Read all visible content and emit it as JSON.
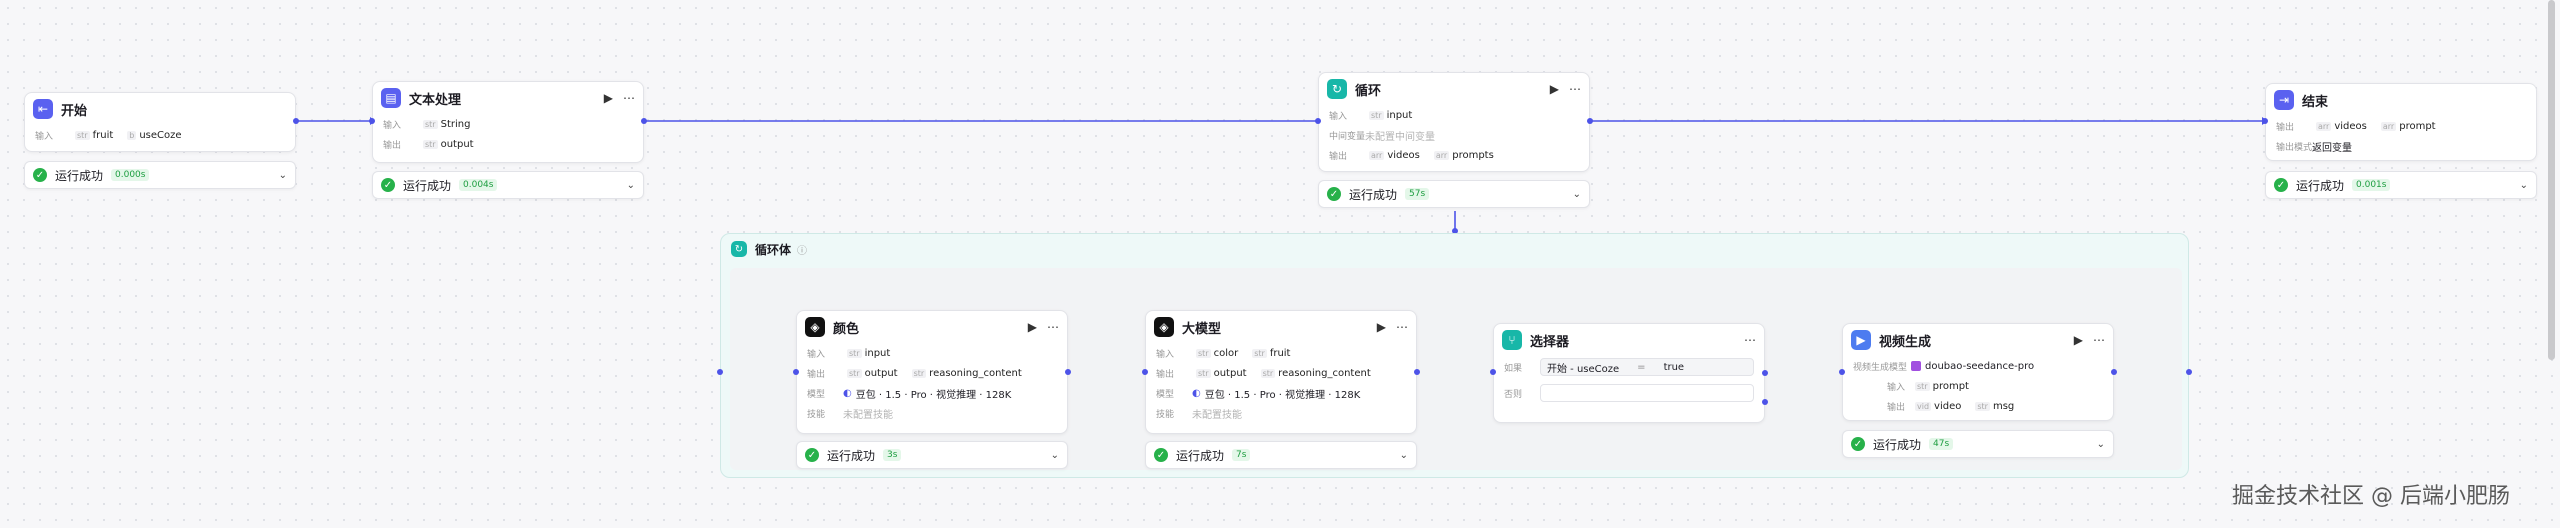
{
  "nodes": {
    "start": {
      "title": "开始",
      "input_label": "输入",
      "inputs": [
        {
          "type": "str",
          "name": "fruit"
        },
        {
          "type": "b",
          "name": "useCoze"
        }
      ],
      "status": "运行成功",
      "time": "0.000s"
    },
    "text": {
      "title": "文本处理",
      "input_label": "输入",
      "output_label": "输出",
      "inputs": [
        {
          "type": "str",
          "name": "String"
        }
      ],
      "outputs": [
        {
          "type": "str",
          "name": "output"
        }
      ],
      "status": "运行成功",
      "time": "0.004s"
    },
    "loop": {
      "title": "循环",
      "input_label": "输入",
      "mid_label": "中间变量",
      "output_label": "输出",
      "inputs": [
        {
          "type": "str",
          "name": "input"
        }
      ],
      "mid_value": "未配置中间变量",
      "outputs": [
        {
          "type": "arr",
          "name": "videos"
        },
        {
          "type": "arr",
          "name": "prompts"
        }
      ],
      "status": "运行成功",
      "time": "57s"
    },
    "end": {
      "title": "结束",
      "output_label": "输出",
      "mode_label": "输出模式",
      "outputs": [
        {
          "type": "arr",
          "name": "videos"
        },
        {
          "type": "arr",
          "name": "prompt"
        }
      ],
      "mode_value": "返回变量",
      "status": "运行成功",
      "time": "0.001s"
    },
    "loop_body": {
      "title": "循环体"
    },
    "color": {
      "title": "颜色",
      "input_label": "输入",
      "output_label": "输出",
      "model_label": "模型",
      "skill_label": "技能",
      "inputs": [
        {
          "type": "str",
          "name": "input"
        }
      ],
      "outputs": [
        {
          "type": "str",
          "name": "output"
        },
        {
          "type": "str",
          "name": "reasoning_content"
        }
      ],
      "model": "豆包 · 1.5 · Pro · 视觉推理 · 128K",
      "skill": "未配置技能",
      "status": "运行成功",
      "time": "3s"
    },
    "llm": {
      "title": "大模型",
      "input_label": "输入",
      "output_label": "输出",
      "model_label": "模型",
      "skill_label": "技能",
      "inputs": [
        {
          "type": "str",
          "name": "color"
        },
        {
          "type": "str",
          "name": "fruit"
        }
      ],
      "outputs": [
        {
          "type": "str",
          "name": "output"
        },
        {
          "type": "str",
          "name": "reasoning_content"
        }
      ],
      "model": "豆包 · 1.5 · Pro · 视觉推理 · 128K",
      "skill": "未配置技能",
      "status": "运行成功",
      "time": "7s"
    },
    "selector": {
      "title": "选择器",
      "if_label": "如果",
      "else_label": "否则",
      "cond_left": "开始 - useCoze",
      "cond_op": "=",
      "cond_right": "true"
    },
    "video": {
      "title": "视频生成",
      "model_label": "视频生成模型",
      "model": "doubao-seedance-pro",
      "input_label": "输入",
      "output_label": "输出",
      "inputs": [
        {
          "type": "str",
          "name": "prompt"
        }
      ],
      "outputs": [
        {
          "type": "vid",
          "name": "video"
        },
        {
          "type": "str",
          "name": "msg"
        }
      ],
      "status": "运行成功",
      "time": "47s"
    }
  },
  "icons": {
    "play": "▶",
    "more": "⋯",
    "chevron": "⌄",
    "check": "✓",
    "info": "ⓘ"
  },
  "watermark": "掘金技术社区 @ 后端小肥肠",
  "colors": {
    "accent": "#4d53e8",
    "loop": "#18b7a8",
    "success": "#27b14a"
  }
}
